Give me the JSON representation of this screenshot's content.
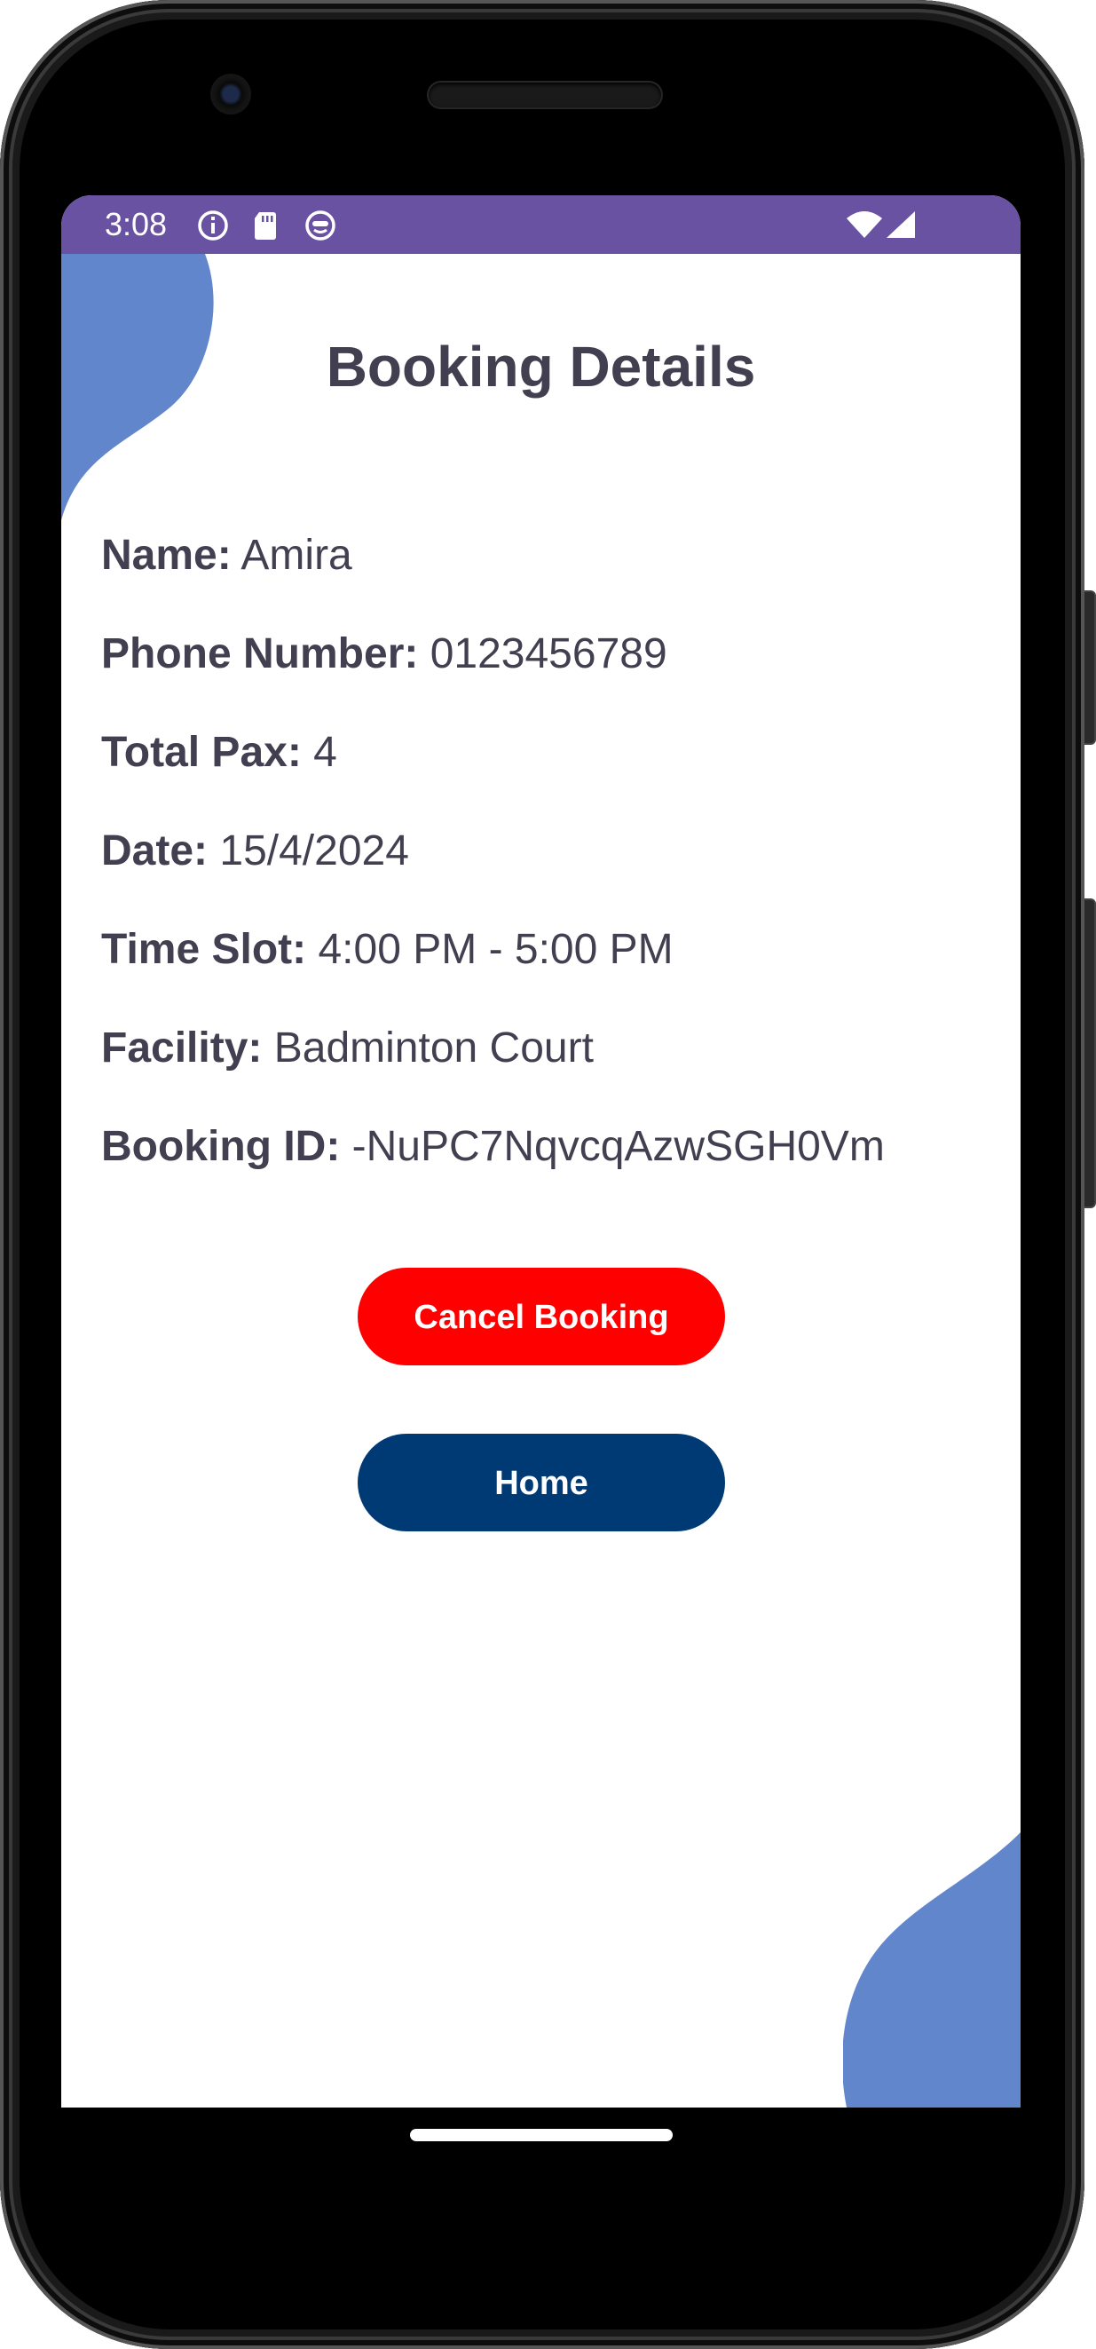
{
  "status_bar": {
    "time": "3:08",
    "color": "#6a52a3",
    "icons": [
      "info-icon",
      "sd-card-icon",
      "notification-app-icon",
      "wifi-icon",
      "cell-signal-icon"
    ]
  },
  "page": {
    "title": "Booking Details",
    "accent_blob_color": "#6286cc"
  },
  "details": [
    {
      "label": "Name:",
      "value": "Amira"
    },
    {
      "label": "Phone Number:",
      "value": "0123456789"
    },
    {
      "label": "Total Pax:",
      "value": "4"
    },
    {
      "label": "Date:",
      "value": "15/4/2024"
    },
    {
      "label": "Time Slot:",
      "value": "4:00 PM - 5:00 PM"
    },
    {
      "label": "Facility:",
      "value": "Badminton Court"
    },
    {
      "label": "Booking ID:",
      "value": "-NuPC7NqvcqAzwSGH0Vm"
    }
  ],
  "buttons": {
    "cancel_label": "Cancel Booking",
    "cancel_color": "#fe0000",
    "home_label": "Home",
    "home_color": "#003a74"
  }
}
